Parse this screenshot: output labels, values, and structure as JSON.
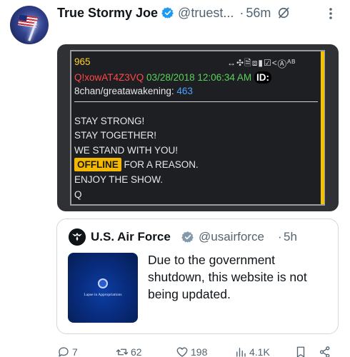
{
  "tweet": {
    "display_name": "True Stormy Joe",
    "handle": "@truest...",
    "separator": "·",
    "time": "56m"
  },
  "post_image": {
    "post_number": "965",
    "tripcode": "Q!xowAT4Z3VQ",
    "datetime": "03/28/2018 12:06:34 AM",
    "id_label": "ID:",
    "board_prefix": "8chan/greatawakening:",
    "board_count": "463",
    "toolbar_glyphs": "↔✣🗎⧈▮☑<Ⓐᴬᴮ",
    "lines": [
      "STAY STRONG!",
      "STAY TOGETHER!",
      "WE STAND WITH YOU!"
    ],
    "offline_word": "OFFLINE",
    "offline_rest": " FOR A REASON.",
    "line_enjoy": "ENJOY THE SHOW.",
    "signature": "Q",
    "colors": {
      "accent_yellow": "#f2c300",
      "trip_red": "#ff4848",
      "date_green": "#5ad25a",
      "board_blue": "#4aa3ff"
    }
  },
  "quoted_tweet": {
    "display_name": "U.S. Air Force",
    "handle": "@usairforce",
    "separator": "·",
    "time": "5h",
    "text": "Due to the government shutdown, this website is not being updated.",
    "thumbnail_caption": "Lapse in Appropriations"
  },
  "actions": {
    "replies": "7",
    "reposts": "62",
    "likes": "198",
    "views": "4.1K"
  },
  "colors": {
    "verified_blue": "#1d9bf0",
    "muted_text": "#536471"
  }
}
